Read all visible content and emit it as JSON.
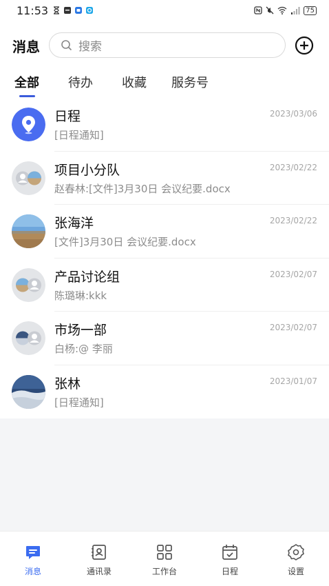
{
  "status_bar": {
    "time": "11:53",
    "battery": "75"
  },
  "header": {
    "title": "消息",
    "search_placeholder": "搜索",
    "tabs": [
      "全部",
      "待办",
      "收藏",
      "服务号"
    ]
  },
  "conversations": [
    {
      "name": "日程",
      "preview": "[日程通知]",
      "date": "2023/03/06",
      "avatar": "calendar-app-icon"
    },
    {
      "name": "项目小分队",
      "preview": "赵春林:[文件]3月30日 会议纪要.docx",
      "date": "2023/02/22",
      "avatar": "group-avatar"
    },
    {
      "name": "张海洋",
      "preview": "[文件]3月30日 会议纪要.docx",
      "date": "2023/02/22",
      "avatar": "landscape-photo"
    },
    {
      "name": "产品讨论组",
      "preview": "陈璐琳:kkk",
      "date": "2023/02/07",
      "avatar": "group-avatar"
    },
    {
      "name": "市场一部",
      "preview": "白杨:@ 李丽",
      "date": "2023/02/07",
      "avatar": "group-avatar"
    },
    {
      "name": "张林",
      "preview": "[日程通知]",
      "date": "2023/01/07",
      "avatar": "snow-photo"
    }
  ],
  "bottom_nav": [
    {
      "label": "消息",
      "icon": "message-icon",
      "active": true
    },
    {
      "label": "通讯录",
      "icon": "contacts-icon",
      "active": false
    },
    {
      "label": "工作台",
      "icon": "workbench-icon",
      "active": false
    },
    {
      "label": "日程",
      "icon": "calendar-icon",
      "active": false
    },
    {
      "label": "设置",
      "icon": "settings-icon",
      "active": false
    }
  ],
  "colors": {
    "accent": "#3b6cf0",
    "background": "#f4f5f7"
  }
}
